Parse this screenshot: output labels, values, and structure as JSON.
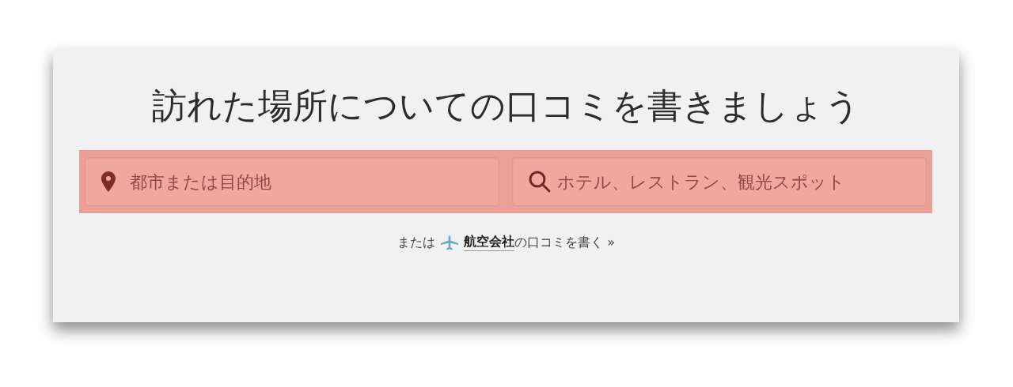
{
  "heading": "訪れた場所についての口コミを書きましょう",
  "search_fields": [
    {
      "kind": "location",
      "placeholder": "都市または目的地"
    },
    {
      "kind": "search",
      "placeholder": "ホテル、レストラン、観光スポット"
    }
  ],
  "footer": {
    "prefix": "または",
    "link": "航空会社",
    "suffix": "の口コミを書く »"
  }
}
